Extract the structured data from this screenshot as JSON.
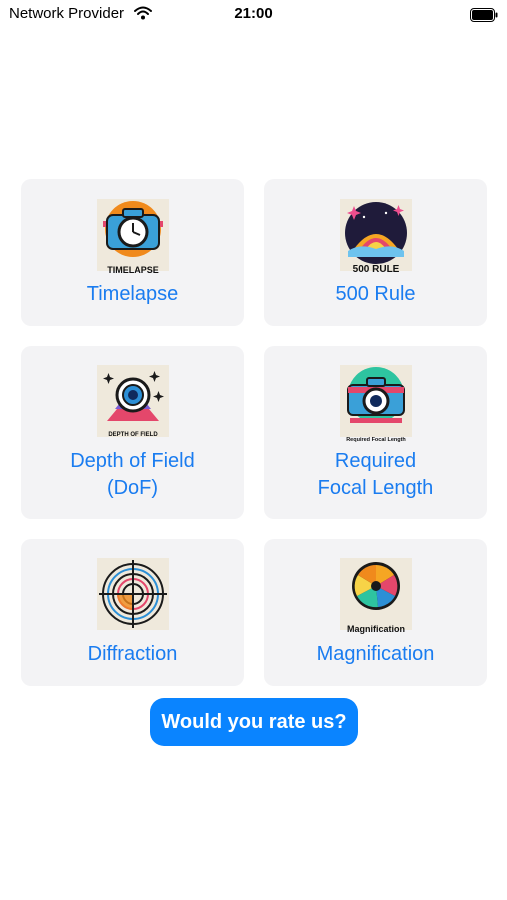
{
  "status_bar": {
    "carrier": "Network Provider",
    "time": "21:00"
  },
  "tools": [
    {
      "label": "Timelapse",
      "icon": "timelapse-icon",
      "icon_text": "TIMELAPSE"
    },
    {
      "label": "500 Rule",
      "icon": "500-rule-icon",
      "icon_text": "500 RULE"
    },
    {
      "label_line1": "Depth of Field",
      "label_line2": "(DoF)",
      "icon": "depth-of-field-icon",
      "icon_text": "DEPTH OF FIELD"
    },
    {
      "label_line1": "Required",
      "label_line2": "Focal Length",
      "icon": "required-focal-length-icon",
      "icon_text": "Required Focal Length"
    },
    {
      "label": "Diffraction",
      "icon": "diffraction-icon"
    },
    {
      "label": "Magnification",
      "icon": "magnification-icon",
      "icon_text": "Magnification"
    }
  ],
  "rate_button": {
    "label": "Would you rate us?"
  },
  "colors": {
    "accent": "#0a84ff",
    "link": "#1a7cf0",
    "card_bg": "#f3f3f5"
  }
}
